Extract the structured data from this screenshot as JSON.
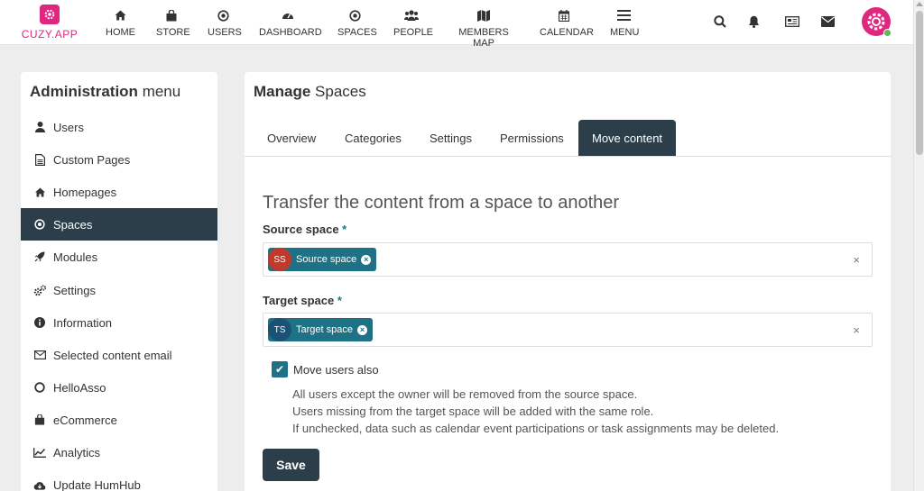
{
  "brand": {
    "name": "CUZY.APP",
    "color": "#e0277f"
  },
  "topnav": [
    {
      "label": "HOME",
      "icon": "home-icon"
    },
    {
      "label": "STORE",
      "icon": "shopping-bag-icon"
    },
    {
      "label": "USERS",
      "icon": "dot-circle-icon"
    },
    {
      "label": "DASHBOARD",
      "icon": "tachometer-icon"
    },
    {
      "label": "SPACES",
      "icon": "dot-circle-icon"
    },
    {
      "label": "PEOPLE",
      "icon": "users-icon"
    },
    {
      "label": "MEMBERS MAP",
      "icon": "map-icon"
    },
    {
      "label": "CALENDAR",
      "icon": "calendar-icon"
    },
    {
      "label": "MENU",
      "icon": "bars-icon"
    }
  ],
  "sidebar": {
    "title_bold": "Administration",
    "title_rest": "menu",
    "items": [
      {
        "label": "Users",
        "icon": "user-icon"
      },
      {
        "label": "Custom Pages",
        "icon": "file-icon"
      },
      {
        "label": "Homepages",
        "icon": "home-icon"
      },
      {
        "label": "Spaces",
        "icon": "dot-circle-icon",
        "active": true
      },
      {
        "label": "Modules",
        "icon": "rocket-icon"
      },
      {
        "label": "Settings",
        "icon": "cogs-icon"
      },
      {
        "label": "Information",
        "icon": "info-circle-icon"
      },
      {
        "label": "Selected content email",
        "icon": "envelope-icon"
      },
      {
        "label": "HelloAsso",
        "icon": "circle-icon"
      },
      {
        "label": "eCommerce",
        "icon": "shopping-bag-icon"
      },
      {
        "label": "Analytics",
        "icon": "line-chart-icon"
      },
      {
        "label": "Update HumHub",
        "icon": "cloud-download-icon"
      }
    ]
  },
  "main": {
    "title_bold": "Manage",
    "title_rest": "Spaces",
    "tabs": [
      {
        "label": "Overview"
      },
      {
        "label": "Categories"
      },
      {
        "label": "Settings"
      },
      {
        "label": "Permissions"
      },
      {
        "label": "Move content",
        "active": true
      }
    ],
    "heading": "Transfer the content from a space to another",
    "source": {
      "label": "Source space",
      "required": "*",
      "chip_initials": "SS",
      "chip_label": "Source space",
      "chip_avatar_color": "#c0392b",
      "clear": "×"
    },
    "target": {
      "label": "Target space",
      "required": "*",
      "chip_initials": "TS",
      "chip_label": "Target space",
      "chip_avatar_color": "#1a5276",
      "clear": "×"
    },
    "move_users": {
      "label": "Move users also",
      "checked": true,
      "help": [
        "All users except the owner will be removed from the source space.",
        "Users missing from the target space will be added with the same role.",
        "If unchecked, data such as calendar event participations or task assignments may be deleted."
      ]
    },
    "save_label": "Save"
  },
  "colors": {
    "dark": "#2c3e4a",
    "accent": "#1f7285",
    "pink": "#e0277f"
  }
}
